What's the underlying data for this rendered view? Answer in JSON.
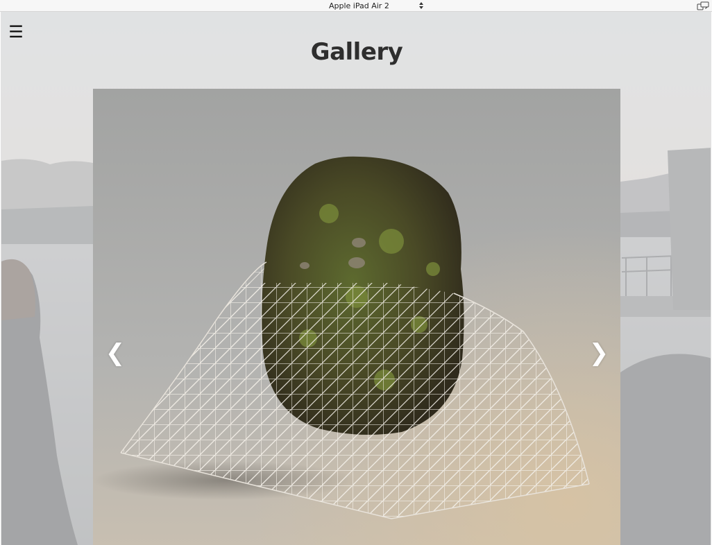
{
  "devbar": {
    "device": "Apple iPad Air 2",
    "rotate_icon": "rotate-device-icon",
    "select_icon": "select-arrows-icon"
  },
  "page": {
    "menu_icon": "hamburger-menu-icon",
    "menu_glyph": "☰",
    "title": "Gallery"
  },
  "gallery": {
    "prev_glyph": "❮",
    "next_glyph": "❯",
    "prev_icon": "chevron-left-icon",
    "next_icon": "chevron-right-icon",
    "slide_subject": "moss-boulder-lattice-sculpture"
  },
  "colors": {
    "title": "#2e2e2e",
    "arrow": "#ffffff",
    "toolbar_bg": "#f7f7f7"
  }
}
